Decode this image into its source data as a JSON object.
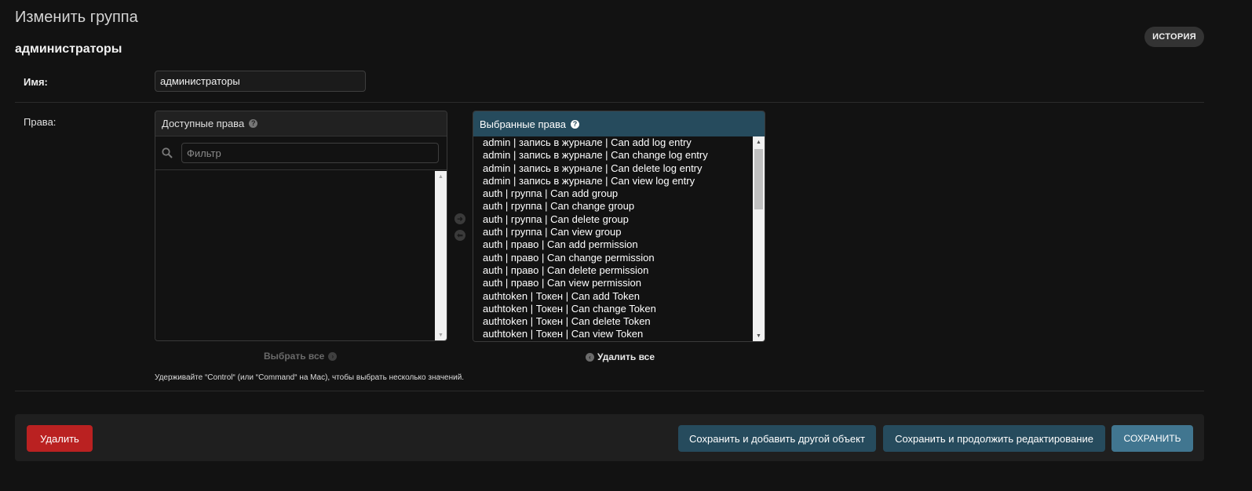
{
  "header": {
    "title": "Изменить группа",
    "object_name": "администраторы",
    "history_label": "ИСТОРИЯ"
  },
  "form": {
    "name_label": "Имя:",
    "name_value": "администраторы",
    "permissions_label": "Права:"
  },
  "available": {
    "title": "Доступные права",
    "help_glyph": "?",
    "filter_placeholder": "Фильтр",
    "choose_all_label": "Выбрать все"
  },
  "chosen": {
    "title": "Выбранные права",
    "help_glyph": "?",
    "remove_all_label": "Удалить все",
    "items": [
      "admin | запись в журнале | Can add log entry",
      "admin | запись в журнале | Can change log entry",
      "admin | запись в журнале | Can delete log entry",
      "admin | запись в журнале | Can view log entry",
      "auth | группа | Can add group",
      "auth | группа | Can change group",
      "auth | группа | Can delete group",
      "auth | группа | Can view group",
      "auth | право | Can add permission",
      "auth | право | Can change permission",
      "auth | право | Can delete permission",
      "auth | право | Can view permission",
      "authtoken | Токен | Can add Token",
      "authtoken | Токен | Can change Token",
      "authtoken | Токен | Can delete Token",
      "authtoken | Токен | Can view Token"
    ]
  },
  "help_text": "Удерживайте “Control“ (или “Command“ на Mac), чтобы выбрать несколько значений.",
  "actions": {
    "delete_label": "Удалить",
    "save_add_label": "Сохранить и добавить другой объект",
    "save_continue_label": "Сохранить и продолжить редактирование",
    "save_label": "СОХРАНИТЬ"
  },
  "colors": {
    "chosen_header": "#264b5d",
    "delete_button": "#ba2121",
    "save_button": "#417690"
  }
}
